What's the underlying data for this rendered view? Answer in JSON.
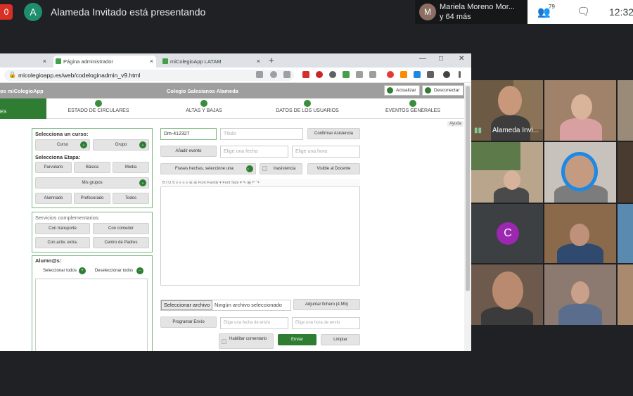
{
  "meet": {
    "rec_badge": "0",
    "presenter_initial": "A",
    "presenting_text": "Alameda Invitado está presentando",
    "participant_initial": "M",
    "participant_name": "Mariela Moreno Mor...",
    "participant_more": "y 64 más",
    "people_count": "79",
    "clock": "12:32",
    "tile_speaker_label": "Alameda Invi...",
    "tile_c_initial": "C"
  },
  "browser": {
    "tab1_label": "",
    "tab2_label": "Página administrador",
    "tab3_label": "miColegioApp LATAM",
    "tab_close": "×",
    "new_tab": "+",
    "win_min": "—",
    "win_max": "□",
    "win_close": "✕",
    "url": "micolegioapp.es/web/codeloginadmin_v9.html"
  },
  "app": {
    "brand": "os miColegioApp",
    "school_name": "Colegio Salesianos Alameda",
    "update_button": "Actualizar",
    "logout_button": "Desconectar",
    "nav_active": "ES",
    "nav": [
      "ESTADO DE CIRCULARES",
      "ALTAS Y BAJAS",
      "DATOS DE LOS USUARIOS",
      "EVENTOS GENERALES"
    ],
    "help": "Ayuda",
    "course_title": "Selecciona un curso:",
    "curso": "Curso",
    "grupo": "Grupo",
    "stage_title": "Selecciona Etapa:",
    "stages": [
      "Parvulario",
      "Básica",
      "Media"
    ],
    "mis_grupos": "Mis grupos",
    "roles": [
      "Alumnado",
      "Profesorado",
      "Todos"
    ],
    "services_title": "Servicios complementarios:",
    "services": [
      "Con transporte",
      "Con comedor",
      "Con activ. extra.",
      "Centro de Padres"
    ],
    "students_title": "Alumn@s:",
    "select_all": "Seleccionar todos",
    "deselect_all": "Deseleccionar todos",
    "code_value": "Dm-412327",
    "title_placeholder": "Título",
    "confirm_attendance": "Confirmar Asistencia",
    "add_event": "Añadir evento",
    "date_placeholder": "Elige una fecha",
    "time_placeholder": "Elige una hora",
    "phrases_select": "Frases hechas, seleccione una:",
    "absence": "Inasistencia",
    "visible_teacher": "Visible al Docente",
    "editor_toolbar": "B  I  U  S  ≡  ≡  ≡  ≡  ☰  ☰   Font Family   ▾   Font Size   ▾   ✎  ▤  ↶  ↷",
    "select_file": "Seleccionar archivo",
    "no_file": "Ningún archivo seleccionado",
    "attach_file": "Adjuntar fichero (4 Mb)",
    "schedule_send": "Programar Envío",
    "send_date_placeholder": "Elige una fecha de envío",
    "send_time_placeholder": "Elige una hora de envío",
    "enable_comment": "Habilitar comentario",
    "send": "Enviar",
    "clear": "Limpiar"
  }
}
